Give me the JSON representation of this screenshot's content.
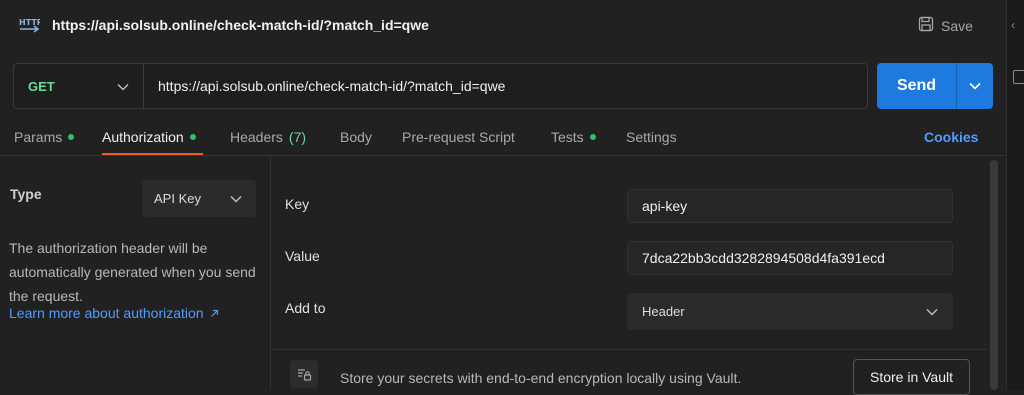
{
  "request": {
    "title": "https://api.solsub.online/check-match-id/?match_id=qwe",
    "save_label": "Save"
  },
  "url_bar": {
    "method": "GET",
    "url": "https://api.solsub.online/check-match-id/?match_id=qwe",
    "send_label": "Send"
  },
  "tabs": {
    "params": "Params",
    "authorization": "Authorization",
    "headers": "Headers",
    "headers_count": "(7)",
    "body": "Body",
    "prerequest": "Pre-request Script",
    "tests": "Tests",
    "settings": "Settings",
    "cookies": "Cookies"
  },
  "auth": {
    "type_label": "Type",
    "type_value": "API Key",
    "description": "The authorization header will be automatically generated when you send the request.",
    "learn_more": "Learn more about authorization",
    "key_label": "Key",
    "key_value": "api-key",
    "value_label": "Value",
    "value_value": "7dca22bb3cdd3282894508d4fa391ecd",
    "addto_label": "Add to",
    "addto_value": "Header"
  },
  "vault": {
    "text": "Store your secrets with end-to-end encryption locally using Vault.",
    "button": "Store in Vault"
  },
  "colors": {
    "accent_blue": "#1f7ae0",
    "method_green": "#6bdd9a",
    "tab_underline": "#ef5b25",
    "dot_green": "#2ebd6b",
    "link_blue": "#4f9cff"
  }
}
